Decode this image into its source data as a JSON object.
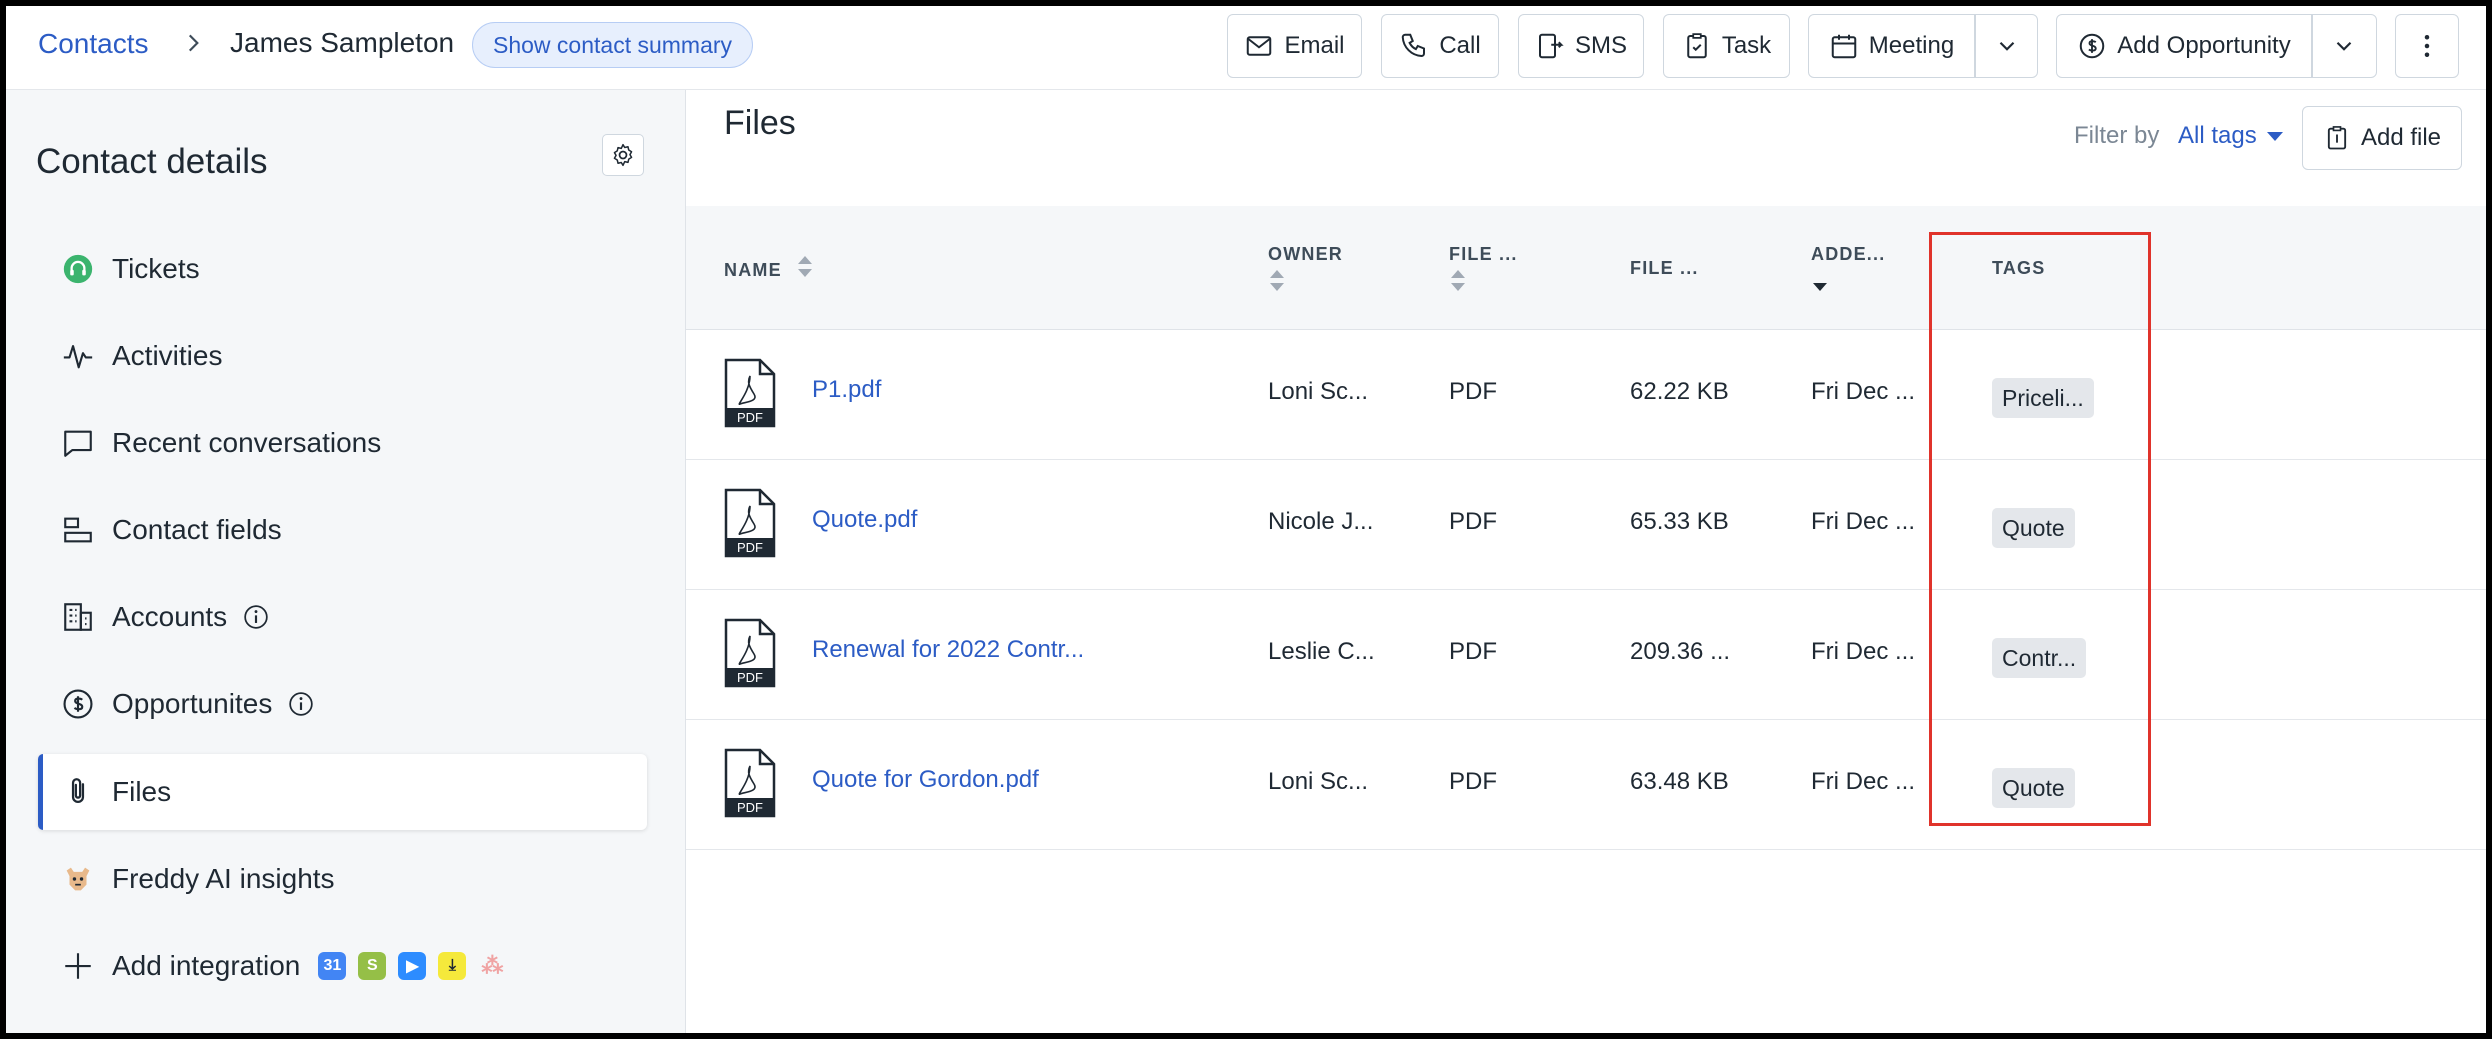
{
  "breadcrumb": {
    "root": "Contacts",
    "current": "James Sampleton"
  },
  "summary_pill": "Show contact summary",
  "toolbar": {
    "email": "Email",
    "call": "Call",
    "sms": "SMS",
    "task": "Task",
    "meeting": "Meeting",
    "add_opportunity": "Add Opportunity"
  },
  "sidebar": {
    "title": "Contact details",
    "items": [
      {
        "label": "Tickets",
        "icon": "headset-icon"
      },
      {
        "label": "Activities",
        "icon": "pulse-icon"
      },
      {
        "label": "Recent conversations",
        "icon": "chat-icon"
      },
      {
        "label": "Contact fields",
        "icon": "fields-icon"
      },
      {
        "label": "Accounts",
        "icon": "building-icon"
      },
      {
        "label": "Opportunites",
        "icon": "dollar-icon"
      },
      {
        "label": "Files",
        "icon": "paperclip-icon"
      },
      {
        "label": "Freddy AI insights",
        "icon": "freddy-icon"
      },
      {
        "label": "Add integration",
        "icon": "plus-icon"
      }
    ],
    "active_item": "Files"
  },
  "files": {
    "title": "Files",
    "filter_label": "Filter by",
    "filter_value": "All tags",
    "add_file": "Add file",
    "columns": [
      "NAME",
      "OWNER",
      "FILE ...",
      "FILE ...",
      "ADDE...",
      "TAGS"
    ],
    "rows": [
      {
        "name": "P1.pdf",
        "owner": "Loni Sc...",
        "type": "PDF",
        "size": "62.22 KB",
        "added": "Fri Dec ...",
        "tag": "Priceli..."
      },
      {
        "name": "Quote.pdf",
        "owner": "Nicole J...",
        "type": "PDF",
        "size": "65.33 KB",
        "added": "Fri Dec ...",
        "tag": "Quote"
      },
      {
        "name": "Renewal for 2022 Contr...",
        "owner": "Leslie C...",
        "type": "PDF",
        "size": "209.36 ...",
        "added": "Fri Dec ...",
        "tag": "Contr..."
      },
      {
        "name": "Quote for Gordon.pdf",
        "owner": "Loni Sc...",
        "type": "PDF",
        "size": "63.48 KB",
        "added": "Fri Dec ...",
        "tag": "Quote"
      }
    ],
    "file_badge": "PDF"
  },
  "colors": {
    "accent": "#2c5cc5",
    "highlight": "#e0332b"
  }
}
